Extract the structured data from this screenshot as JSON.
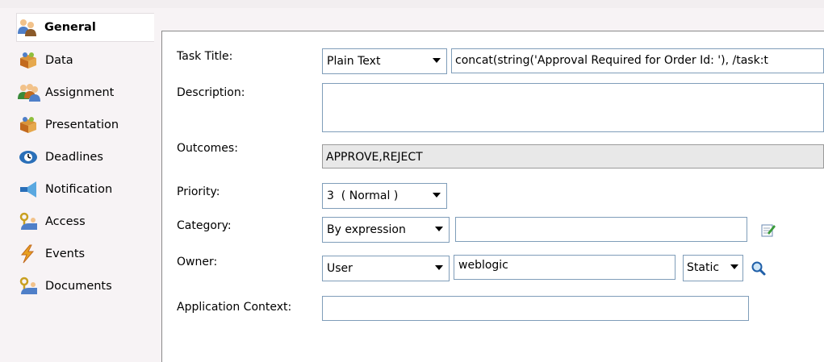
{
  "sidebar": {
    "items": [
      {
        "label": "General",
        "icon": "people-icon"
      },
      {
        "label": "Data",
        "icon": "box-icon"
      },
      {
        "label": "Assignment",
        "icon": "users-icon"
      },
      {
        "label": "Presentation",
        "icon": "box-icon"
      },
      {
        "label": "Deadlines",
        "icon": "clock-icon"
      },
      {
        "label": "Notification",
        "icon": "megaphone-icon"
      },
      {
        "label": "Access",
        "icon": "key-user-icon"
      },
      {
        "label": "Events",
        "icon": "lightning-icon"
      },
      {
        "label": "Documents",
        "icon": "key-user-icon"
      }
    ]
  },
  "form": {
    "task_title": {
      "label": "Task Title:",
      "type_value": "Plain Text",
      "value": "concat(string('Approval Required for Order Id: '), /task:t"
    },
    "description": {
      "label": "Description:",
      "value": ""
    },
    "outcomes": {
      "label": "Outcomes:",
      "value": "APPROVE,REJECT"
    },
    "priority": {
      "label": "Priority:",
      "value": "3  ( Normal )"
    },
    "category": {
      "label": "Category:",
      "type_value": "By expression",
      "value": ""
    },
    "owner": {
      "label": "Owner:",
      "type_value": "User",
      "value": "weblogic",
      "mode_value": "Static"
    },
    "app_context": {
      "label": "Application Context:",
      "value": ""
    }
  },
  "colors": {
    "background": "#f7f3f5",
    "panel": "#ffffff",
    "field_border": "#7f9db9",
    "readonly": "#e8e8e8"
  }
}
